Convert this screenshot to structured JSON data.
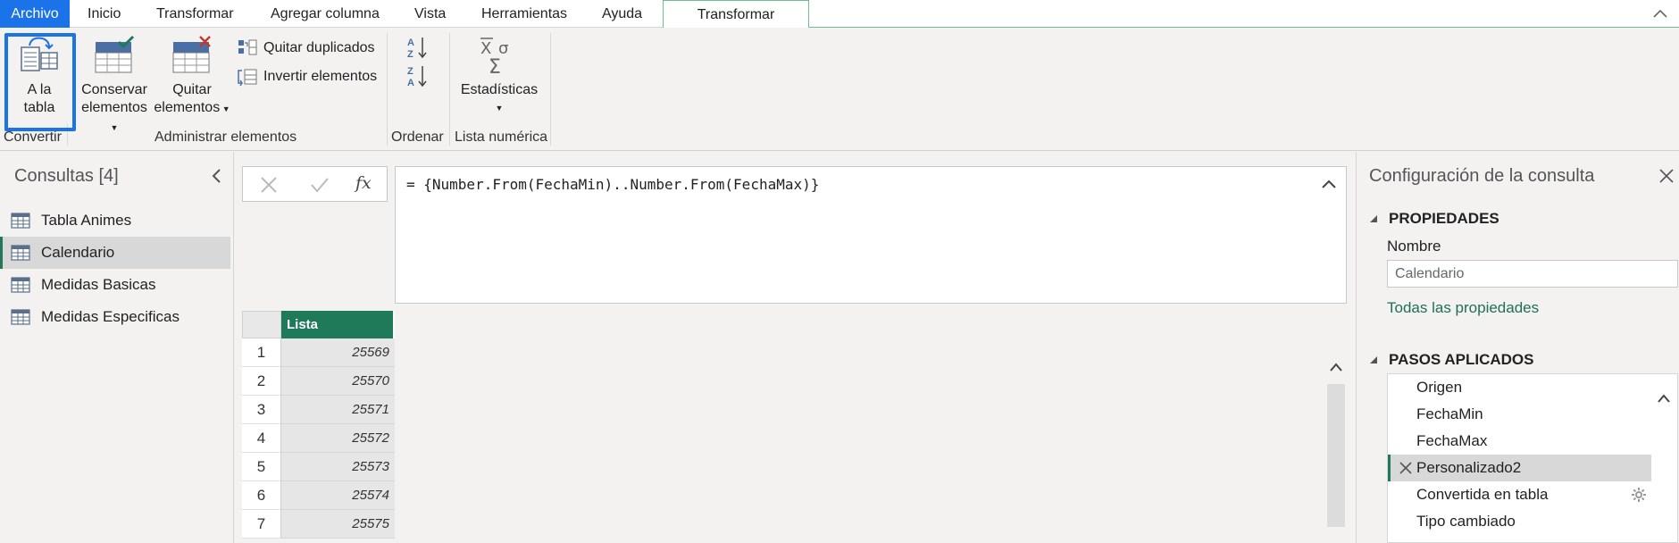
{
  "menu": {
    "file": "Archivo",
    "tabs": [
      "Inicio",
      "Transformar",
      "Agregar columna",
      "Vista",
      "Herramientas",
      "Ayuda"
    ],
    "contextual_tab": "Transformar"
  },
  "ribbon": {
    "to_table": {
      "line1": "A la",
      "line2": "tabla"
    },
    "keep": {
      "line1": "Conservar",
      "line2": "elementos"
    },
    "remove": {
      "line1": "Quitar",
      "line2": "elementos"
    },
    "remove_duplicates": "Quitar duplicados",
    "reverse": "Invertir elementos",
    "statistics": "Estadísticas",
    "groups": {
      "convert": "Convertir",
      "manage": "Administrar elementos",
      "sort": "Ordenar",
      "numeric_list": "Lista numérica"
    }
  },
  "queries": {
    "title": "Consultas [4]",
    "items": [
      {
        "label": "Tabla Animes",
        "selected": false
      },
      {
        "label": "Calendario",
        "selected": true
      },
      {
        "label": "Medidas Basicas",
        "selected": false
      },
      {
        "label": "Medidas Especificas",
        "selected": false
      }
    ]
  },
  "formula": {
    "fx": "fx",
    "text": "= {Number.From(FechaMin)..Number.From(FechaMax)}"
  },
  "grid": {
    "column": "Lista",
    "rows": [
      {
        "n": "1",
        "v": "25569"
      },
      {
        "n": "2",
        "v": "25570"
      },
      {
        "n": "3",
        "v": "25571"
      },
      {
        "n": "4",
        "v": "25572"
      },
      {
        "n": "5",
        "v": "25573"
      },
      {
        "n": "6",
        "v": "25574"
      },
      {
        "n": "7",
        "v": "25575"
      }
    ]
  },
  "settings": {
    "title": "Configuración de la consulta",
    "properties_header": "PROPIEDADES",
    "name_label": "Nombre",
    "name_value": "Calendario",
    "all_properties": "Todas las propiedades",
    "steps_header": "PASOS APLICADOS",
    "steps": [
      {
        "label": "Origen",
        "selected": false,
        "gear": false
      },
      {
        "label": "FechaMin",
        "selected": false,
        "gear": false
      },
      {
        "label": "FechaMax",
        "selected": false,
        "gear": false
      },
      {
        "label": "Personalizado2",
        "selected": true,
        "gear": false
      },
      {
        "label": "Convertida en tabla",
        "selected": false,
        "gear": true
      },
      {
        "label": "Tipo cambiado",
        "selected": false,
        "gear": false
      }
    ]
  },
  "colors": {
    "accent_blue": "#1a73e8",
    "accent_green": "#1f7a5a"
  }
}
